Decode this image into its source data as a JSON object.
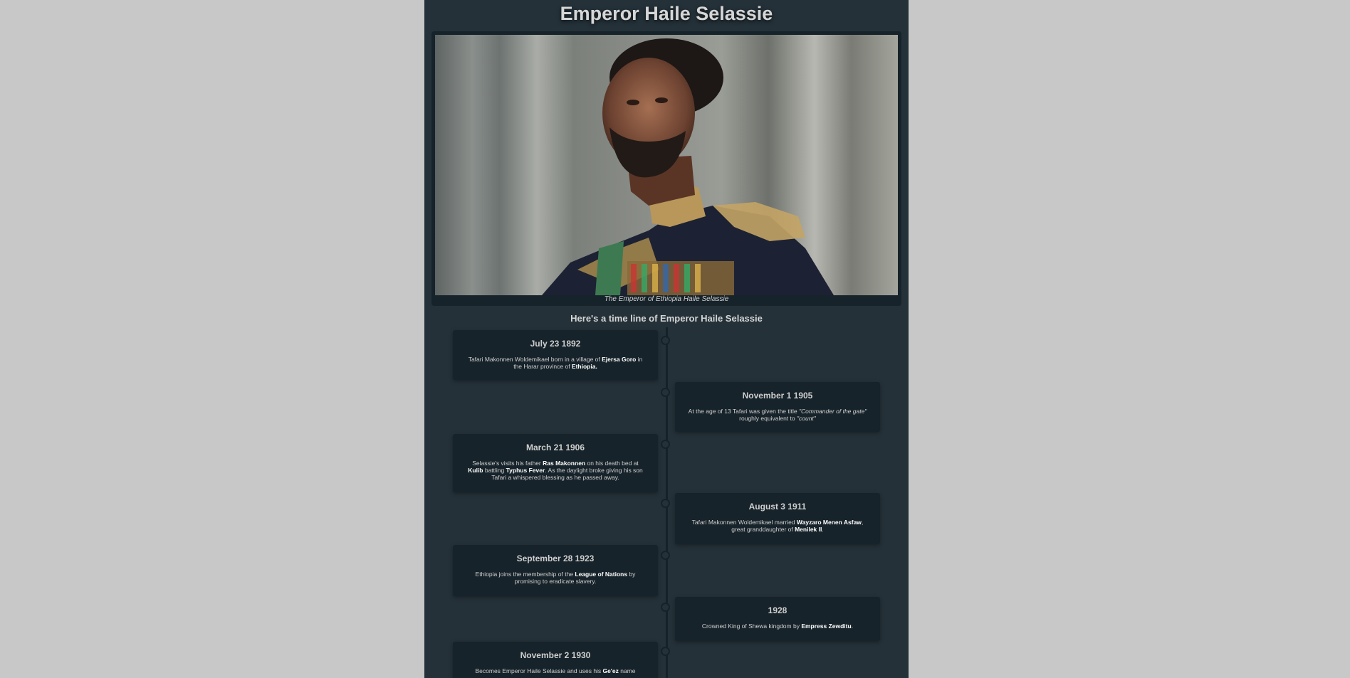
{
  "page": {
    "title": "Emperor Haile Selassie",
    "caption": "The Emperor of Ethiopia Haile Selassie",
    "subtitle": "Here's a time line of Emperor Haile Selassie"
  },
  "timeline": [
    {
      "date": "July 23 1892",
      "t1": "Tafari Makonnen Woldemikael born in a village of ",
      "b1": "Ejersa Goro",
      "t2": " in the Harar province of ",
      "b2": "Ethiopia.",
      "t3": ""
    },
    {
      "date": "November 1 1905",
      "t1": "At the age of 13 Tafari was given the title ",
      "i1": "\"Commander of the gate\"",
      "t2": " roughly equivalent to ",
      "i2": "\"count\""
    },
    {
      "date": "March 21 1906",
      "t1": "Selassie's visits his father ",
      "b1": "Ras Makonnen",
      "t2": " on his death bed at ",
      "b2": "Kulib",
      "t3": " battling ",
      "b3": "Typhus Fever",
      "t4": ". As the daylight broke giving his son Tafari a whispered blessing as he passed away."
    },
    {
      "date": "August 3 1911",
      "t1": "Tafari Makonnen Woldemikael married ",
      "b1": "Wayzaro Menen Asfaw",
      "t2": ", great granddaughter of ",
      "b2": "Menilek II",
      "t3": "."
    },
    {
      "date": "September 28 1923",
      "t1": "Ethiopia joins the membership of the ",
      "b1": "League of Nations",
      "t2": " by promising to eradicate slavery."
    },
    {
      "date": "1928",
      "t1": "Crowned King of Shewa kingdom by ",
      "b1": "Empress Zewditu",
      "t2": "."
    },
    {
      "date": "November 2 1930",
      "t1": "Becomes Emperor Haile Selassie and uses his ",
      "b1": "Ge'ez",
      "t2": " name"
    }
  ]
}
